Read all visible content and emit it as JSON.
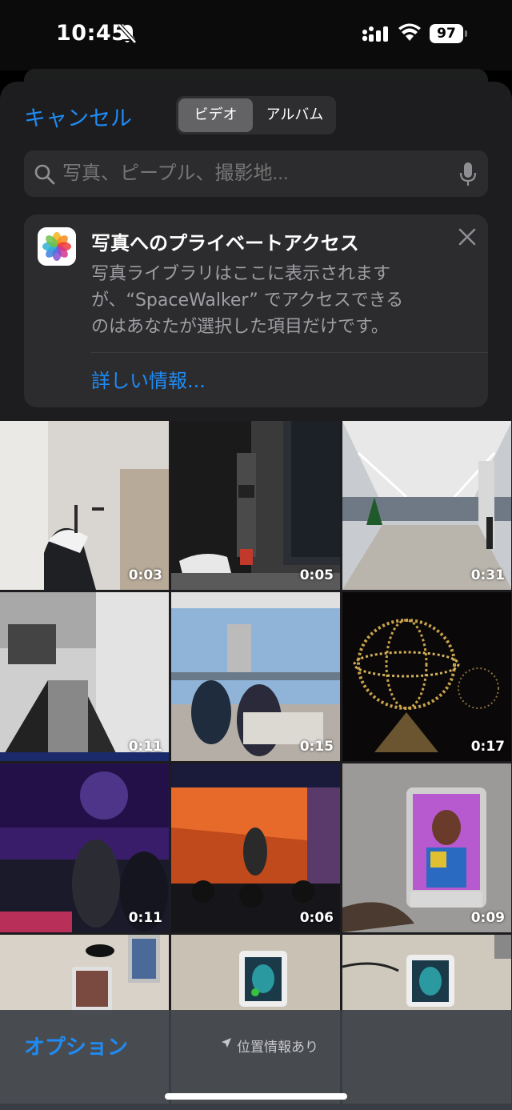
{
  "status_bar": {
    "time": "10:45",
    "battery": "97"
  },
  "sheet": {
    "cancel": "キャンセル",
    "tabs": [
      {
        "label": "ビデオ",
        "selected": true
      },
      {
        "label": "アルバム",
        "selected": false
      }
    ],
    "search": {
      "placeholder": "写真、ピープル、撮影地..."
    }
  },
  "privacy_card": {
    "title": "写真へのプライベートアクセス",
    "body_lines": [
      "写真ライブラリはここに表示されます",
      "が、“SpaceWalker” でアクセスできる",
      "のはあなたが選択した項目だけです。"
    ],
    "link": "詳しい情報..."
  },
  "videos": [
    {
      "duration": "0:03"
    },
    {
      "duration": "0:05"
    },
    {
      "duration": "0:31"
    },
    {
      "duration": "0:11"
    },
    {
      "duration": "0:15"
    },
    {
      "duration": "0:17"
    },
    {
      "duration": "0:11"
    },
    {
      "duration": "0:06"
    },
    {
      "duration": "0:09"
    },
    {
      "duration": ""
    },
    {
      "duration": ""
    },
    {
      "duration": ""
    }
  ],
  "bottom_bar": {
    "options": "オプション",
    "location": "位置情報あり"
  },
  "colors": {
    "accent": "#1f8bf5",
    "sheet_bg": "#1d1d1f",
    "card_bg": "#2c2c2e"
  }
}
